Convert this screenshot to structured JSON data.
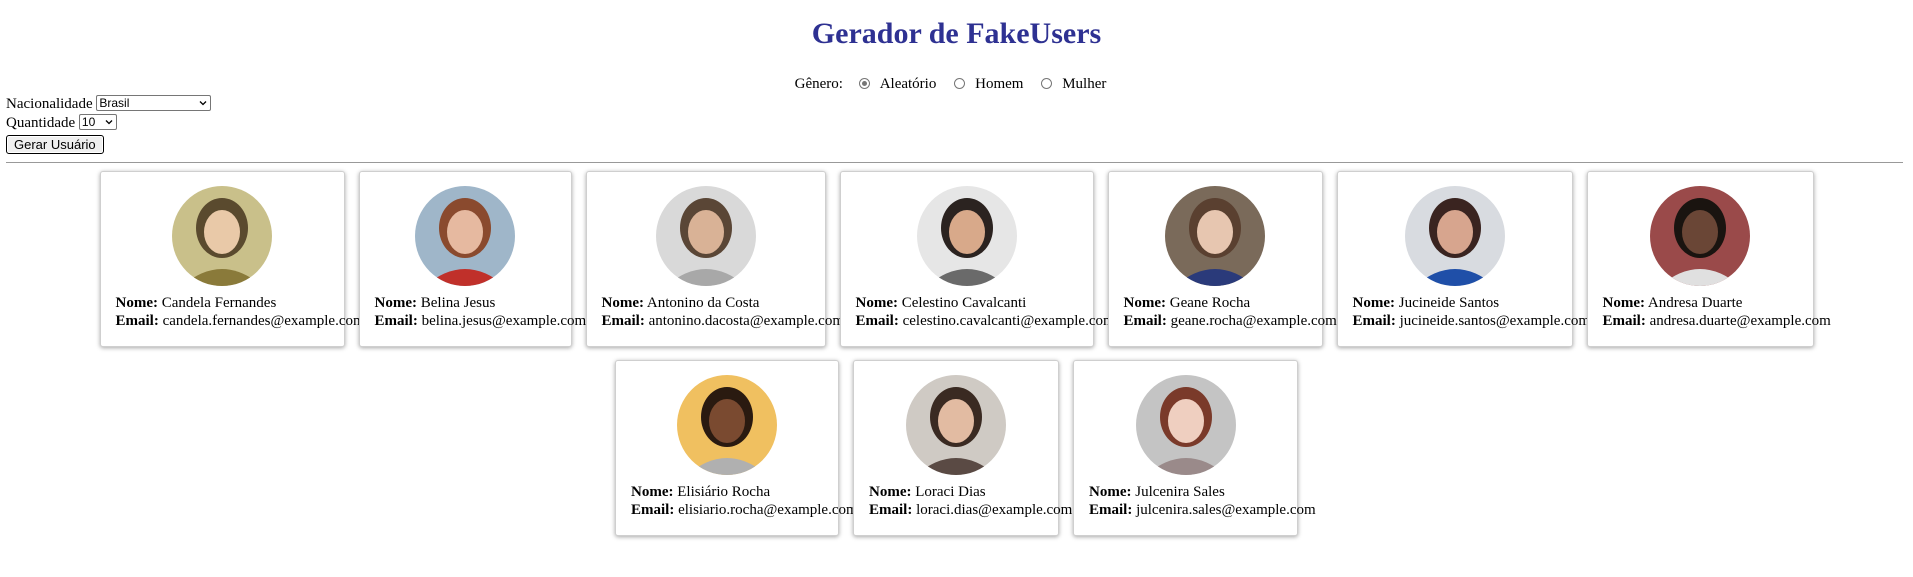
{
  "title": "Gerador de FakeUsers",
  "gender": {
    "label": "Gênero:",
    "options": [
      "Aleatório",
      "Homem",
      "Mulher"
    ],
    "selected": "Aleatório"
  },
  "controls": {
    "nationality_label": "Nacionalidade",
    "nationality_value": "Brasil",
    "quantity_label": "Quantidade",
    "quantity_value": "10",
    "generate_button": "Gerar Usuário"
  },
  "field_labels": {
    "name": "Nome:",
    "email": "Email:"
  },
  "users": [
    {
      "name": "Candela Fernandes",
      "email": "candela.fernandes@example.com"
    },
    {
      "name": "Belina Jesus",
      "email": "belina.jesus@example.com"
    },
    {
      "name": "Antonino da Costa",
      "email": "antonino.dacosta@example.com"
    },
    {
      "name": "Celestino Cavalcanti",
      "email": "celestino.cavalcanti@example.com"
    },
    {
      "name": "Geane Rocha",
      "email": "geane.rocha@example.com"
    },
    {
      "name": "Jucineide Santos",
      "email": "jucineide.santos@example.com"
    },
    {
      "name": "Andresa Duarte",
      "email": "andresa.duarte@example.com"
    },
    {
      "name": "Elisiário Rocha",
      "email": "elisiario.rocha@example.com"
    },
    {
      "name": "Loraci Dias",
      "email": "loraci.dias@example.com"
    },
    {
      "name": "Julcenira Sales",
      "email": "julcenira.sales@example.com"
    }
  ],
  "colors": {
    "title": "#2e3192"
  }
}
